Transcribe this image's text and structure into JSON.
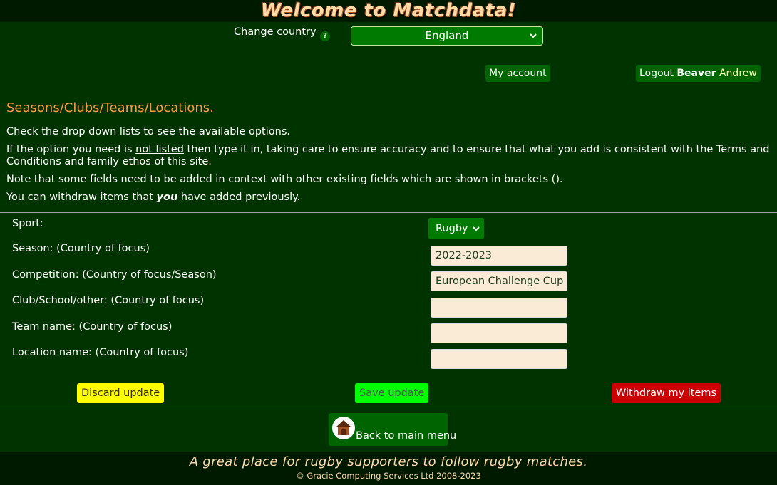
{
  "header": {
    "title": "Welcome to Matchdata!"
  },
  "country": {
    "label": "Change country",
    "help_glyph": "?",
    "selected": "England"
  },
  "account": {
    "my_account": "My account",
    "logout_prefix": "Logout",
    "surname": "Beaver",
    "first_name": "Andrew"
  },
  "section": {
    "title": "Seasons/Clubs/Teams/Locations.",
    "p1": "Check the drop down lists to see the available options.",
    "p2_before": "If the option you need is ",
    "p2_underlined": "not listed",
    "p2_after": " then type it in, taking care to ensure accuracy and to ensure that what you add is consistent with the Terms and Conditions and family ethos of this site.",
    "p3": "Note that some fields need to be added in context with other existing fields which are shown in brackets ().",
    "p4_before": "You can withdraw items that ",
    "p4_em": "you",
    "p4_after": " have added previously."
  },
  "form": {
    "sport": {
      "label": "Sport:",
      "value": "Rugby"
    },
    "season": {
      "label": "Season: (Country of focus)",
      "value": "2022-2023"
    },
    "competition": {
      "label": "Competition: (Country of focus/Season)",
      "value": "European Challenge Cup"
    },
    "club": {
      "label": "Club/School/other: (Country of focus)",
      "value": ""
    },
    "team": {
      "label": "Team name: (Country of focus)",
      "value": ""
    },
    "location": {
      "label": "Location name: (Country of focus)",
      "value": ""
    }
  },
  "actions": {
    "discard": "Discard update",
    "save": "Save update",
    "withdraw": "Withdraw my items",
    "back": "Back to main menu"
  },
  "footer": {
    "tagline": "A great place for rugby supporters to follow rugby matches.",
    "copyright": "© Gracie Computing Services Ltd 2008-2023"
  },
  "colors": {
    "background": "#003300",
    "accent_orange": "#ff9a3c",
    "discard": "#ffff00",
    "save": "#00ff00",
    "withdraw": "#cc0000"
  }
}
